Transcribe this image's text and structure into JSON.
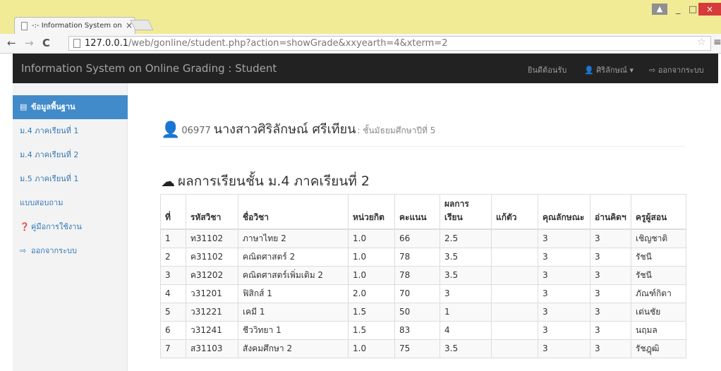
{
  "browser": {
    "tab_title": "-:- Information System on",
    "tab_close": "×",
    "url_host": "127.0.0.1",
    "url_path": "/web/gonline/student.php?action=showGrade&xxyearth=4&xterm=2",
    "win_minimize": "_",
    "win_maximize": "□",
    "win_close": "×",
    "back": "←",
    "forward": "→",
    "reload": "C",
    "star": "☆",
    "menu": "≡",
    "user_badge": "▲"
  },
  "navbar": {
    "brand": "Information System on Online Grading : Student",
    "welcome": "ยินดีต้อนรับ",
    "user": "ศิริลักษณ์",
    "user_caret": "▾",
    "logout": "ออกจากระบบ"
  },
  "sidebar": {
    "items": [
      {
        "label": "ข้อมูลพื้นฐาน"
      },
      {
        "label": "ม.4 ภาคเรียนที่ 1"
      },
      {
        "label": "ม.4 ภาคเรียนที่ 2"
      },
      {
        "label": "ม.5 ภาคเรียนที่ 1"
      },
      {
        "label": "แบบสอบถาม"
      },
      {
        "label": "คู่มือการใช้งาน"
      },
      {
        "label": "ออกจากระบบ"
      }
    ]
  },
  "student": {
    "id": "06977",
    "name": "นางสาวศิริลักษณ์ ศรีเทียน",
    "grade": ": ชั้นมัธยมศึกษาปีที่ 5"
  },
  "section": {
    "title": "ผลการเรียนชั้น ม.4 ภาคเรียนที่ 2"
  },
  "table": {
    "headers": [
      "ที่",
      "รหัสวิชา",
      "ชื่อวิชา",
      "หน่วยกิต",
      "คะแนน",
      "ผลการเรียน",
      "แก้ตัว",
      "คุณลักษณะ",
      "อ่านคิดฯ",
      "ครูผู้สอน"
    ],
    "rows": [
      [
        "1",
        "ท31102",
        "ภาษาไทย 2",
        "1.0",
        "66",
        "2.5",
        "",
        "3",
        "3",
        "เชิญชาติ"
      ],
      [
        "2",
        "ค31102",
        "คณิตศาสตร์ 2",
        "1.0",
        "78",
        "3.5",
        "",
        "3",
        "3",
        "รัชนี"
      ],
      [
        "3",
        "ค31202",
        "คณิตศาสตร์เพิ่มเติม 2",
        "1.0",
        "78",
        "3.5",
        "",
        "3",
        "3",
        "รัชนี"
      ],
      [
        "4",
        "ว31201",
        "ฟิสิกส์ 1",
        "2.0",
        "70",
        "3",
        "",
        "3",
        "3",
        "ภัณฑ์กิตา"
      ],
      [
        "5",
        "ว31221",
        "เคมี 1",
        "1.5",
        "50",
        "1",
        "",
        "3",
        "3",
        "เด่นชัย"
      ],
      [
        "6",
        "ว31241",
        "ชีววิทยา 1",
        "1.5",
        "83",
        "4",
        "",
        "3",
        "3",
        "นฤมล"
      ],
      [
        "7",
        "ส31103",
        "สังคมศึกษา 2",
        "1.0",
        "75",
        "3.5",
        "",
        "3",
        "3",
        "รัชฎุฒิ"
      ]
    ]
  },
  "colors": {
    "titlebar": "#f1eb96",
    "navbar": "#222222",
    "sidebar_active": "#428bca",
    "link": "#337ab7"
  }
}
